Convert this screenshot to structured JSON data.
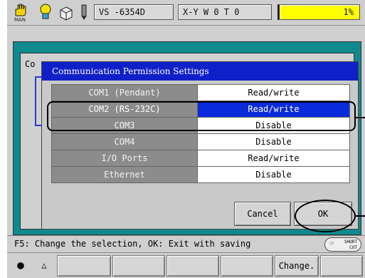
{
  "topbar": {
    "mode_label": "MAN",
    "job_name": "VS -6354D",
    "coord_mode": "X-Y   W 0 T 0",
    "speed": "1%"
  },
  "background": {
    "window_title": "Co"
  },
  "dialog": {
    "title": "Communication Permission Settings",
    "rows": [
      {
        "port": "COM1 (Pendant)",
        "value": "Read/write"
      },
      {
        "port": "COM2 (RS-232C)",
        "value": "Read/write"
      },
      {
        "port": "COM3",
        "value": "Disable"
      },
      {
        "port": "COM4",
        "value": "Disable"
      },
      {
        "port": "I/O Ports",
        "value": "Read/write"
      },
      {
        "port": "Ethernet",
        "value": "Disable"
      }
    ],
    "selected_row": 1,
    "cancel_label": "Cancel",
    "ok_label": "OK"
  },
  "message": "F5: Change the selection,  OK: Exit with saving",
  "shortcut": {
    "line1": "SHORT",
    "line2": "CUT"
  },
  "fkeys": {
    "f1": "",
    "f2": "",
    "f3": "",
    "f4": "",
    "f5": "Change.",
    "f6": ""
  },
  "colors": {
    "selection": "#0a2bdc",
    "title_bar": "#1020c8",
    "speed_bg": "#ffff00",
    "background_window": "#0e8a8f"
  }
}
